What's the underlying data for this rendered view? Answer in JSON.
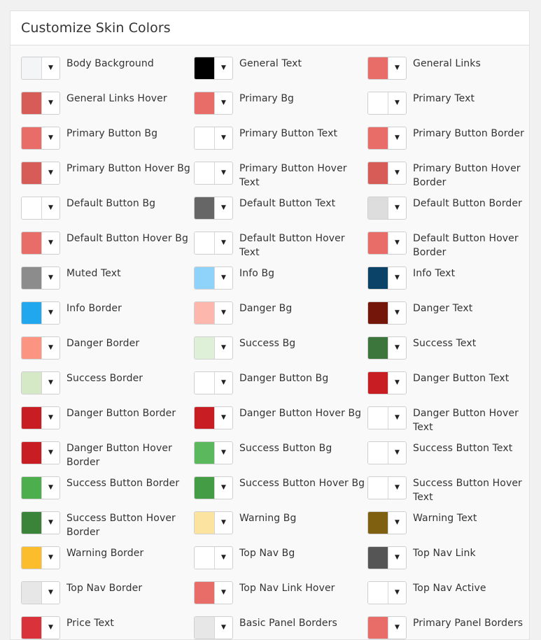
{
  "title": "Customize Skin Colors",
  "dropdown_glyph": "▼",
  "items": [
    {
      "label": "Body Background",
      "color": "#f4f5f6"
    },
    {
      "label": "General Text",
      "color": "#000000"
    },
    {
      "label": "General Links",
      "color": "#e86c67"
    },
    {
      "label": "General Links Hover",
      "color": "#d75b57"
    },
    {
      "label": "Primary Bg",
      "color": "#e86c67"
    },
    {
      "label": "Primary Text",
      "color": "#ffffff"
    },
    {
      "label": "Primary Button Bg",
      "color": "#e86c67"
    },
    {
      "label": "Primary Button Text",
      "color": "#ffffff"
    },
    {
      "label": "Primary Button Border",
      "color": "#e86c67"
    },
    {
      "label": "Primary Button Hover Bg",
      "color": "#d75b57"
    },
    {
      "label": "Primary Button Hover Text",
      "color": "#ffffff"
    },
    {
      "label": "Primary Button Hover Border",
      "color": "#d75b57"
    },
    {
      "label": "Default Button Bg",
      "color": "#ffffff"
    },
    {
      "label": "Default Button Text",
      "color": "#666666"
    },
    {
      "label": "Default Button Border",
      "color": "#dddddd"
    },
    {
      "label": "Default Button Hover Bg",
      "color": "#e86c67"
    },
    {
      "label": "Default Button Hover Text",
      "color": "#ffffff"
    },
    {
      "label": "Default Button Hover Border",
      "color": "#e86c67"
    },
    {
      "label": "Muted Text",
      "color": "#8c8c8c"
    },
    {
      "label": "Info Bg",
      "color": "#8fd3fa"
    },
    {
      "label": "Info Text",
      "color": "#0b4368"
    },
    {
      "label": "Info Border",
      "color": "#20a7ee"
    },
    {
      "label": "Danger Bg",
      "color": "#fdb7ad"
    },
    {
      "label": "Danger Text",
      "color": "#741609"
    },
    {
      "label": "Danger Border",
      "color": "#fb9582"
    },
    {
      "label": "Success Bg",
      "color": "#dff0d8"
    },
    {
      "label": "Success Text",
      "color": "#3c763d"
    },
    {
      "label": "Success Border",
      "color": "#d6e9c6"
    },
    {
      "label": "Danger Button Bg",
      "color": "#ffffff"
    },
    {
      "label": "Danger Button Text",
      "color": "#c81d22"
    },
    {
      "label": "Danger Button Border",
      "color": "#c81d22"
    },
    {
      "label": "Danger Button Hover Bg",
      "color": "#c81d22"
    },
    {
      "label": "Danger Button Hover Text",
      "color": "#ffffff"
    },
    {
      "label": "Danger Button Hover Border",
      "color": "#c81d22"
    },
    {
      "label": "Success Button Bg",
      "color": "#5cb85c"
    },
    {
      "label": "Success Button Text",
      "color": "#ffffff"
    },
    {
      "label": "Success Button Border",
      "color": "#4cae4c"
    },
    {
      "label": "Success Button Hover Bg",
      "color": "#449d44"
    },
    {
      "label": "Success Button Hover Text",
      "color": "#ffffff"
    },
    {
      "label": "Success Button Hover Border",
      "color": "#398439"
    },
    {
      "label": "Warning Bg",
      "color": "#fde3a0"
    },
    {
      "label": "Warning Text",
      "color": "#7f5f10"
    },
    {
      "label": "Warning Border",
      "color": "#fbbd2b"
    },
    {
      "label": "Top Nav Bg",
      "color": "#ffffff"
    },
    {
      "label": "Top Nav Link",
      "color": "#555555"
    },
    {
      "label": "Top Nav Border",
      "color": "#e7e7e7"
    },
    {
      "label": "Top Nav Link Hover",
      "color": "#e86c67"
    },
    {
      "label": "Top Nav Active",
      "color": "#ffffff"
    },
    {
      "label": "Price Text",
      "color": "#d9323a"
    },
    {
      "label": "Basic Panel Borders",
      "color": "#e7e7e7"
    },
    {
      "label": "Primary Panel Borders",
      "color": "#e86c67"
    }
  ]
}
